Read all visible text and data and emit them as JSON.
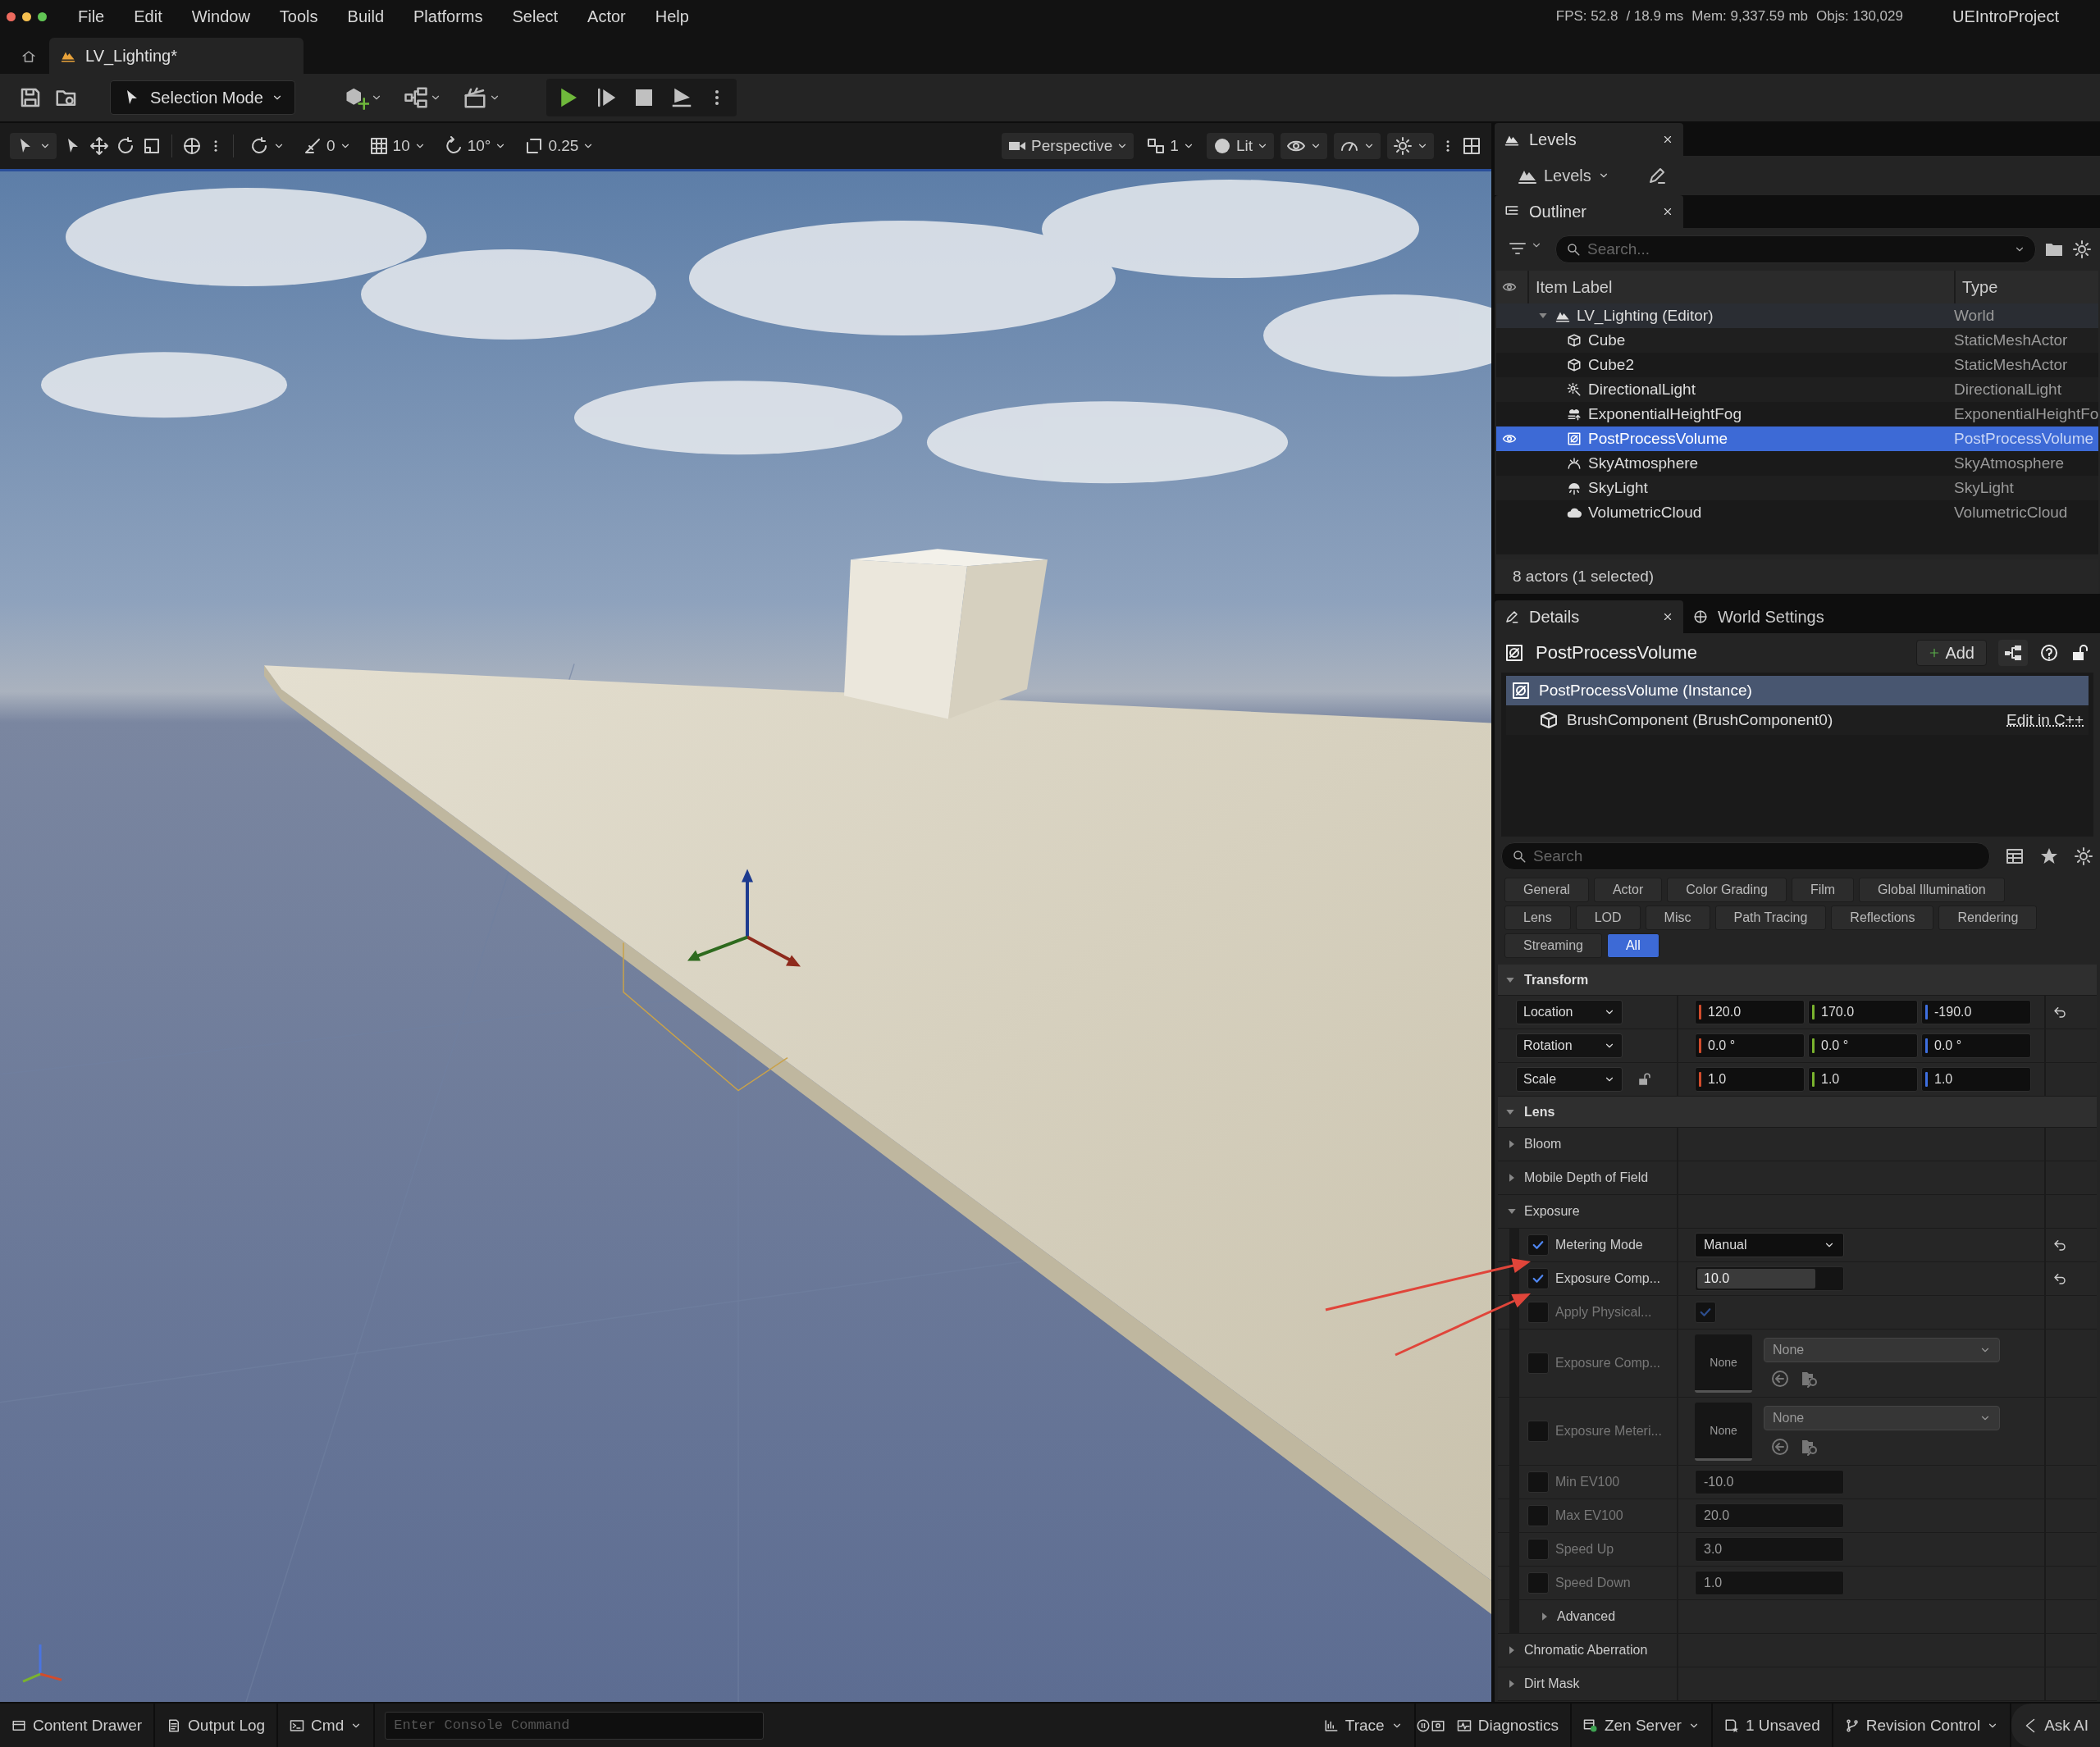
{
  "menu_bar": {
    "items": [
      "File",
      "Edit",
      "Window",
      "Tools",
      "Build",
      "Platforms",
      "Select",
      "Actor",
      "Help"
    ],
    "stats": [
      "FPS: 52.8",
      "/ 18.9 ms",
      "Mem: 9,337.59 mb",
      "Objs: 130,029"
    ],
    "project": "UEIntroProject"
  },
  "document_tab": {
    "label": "LV_Lighting*"
  },
  "toolbar": {
    "mode": "Selection Mode"
  },
  "viewport_toolbar": {
    "snaps": [
      {
        "kind": "surface",
        "value": "0"
      },
      {
        "kind": "grid",
        "value": "10"
      },
      {
        "kind": "rotation",
        "value": "10°"
      },
      {
        "kind": "scale",
        "value": "0.25"
      }
    ],
    "view_mode": "Perspective",
    "layout": "1",
    "lighting": "Lit"
  },
  "levels": {
    "tab": "Levels",
    "dropdown": "Levels"
  },
  "outliner": {
    "tab": "Outliner",
    "search": {
      "placeholder": "Search..."
    },
    "columns": [
      "Item Label",
      "Type"
    ],
    "rows": [
      {
        "kind": "world",
        "label": "LV_Lighting (Editor)",
        "type": "World",
        "selected": false,
        "expanded": true,
        "children": [
          {
            "kind": "mesh",
            "label": "Cube",
            "type": "StaticMeshActor",
            "selected": false
          },
          {
            "kind": "mesh",
            "label": "Cube2",
            "type": "StaticMeshActor",
            "selected": false
          },
          {
            "kind": "directional_light",
            "label": "DirectionalLight",
            "type": "DirectionalLight",
            "selected": false
          },
          {
            "kind": "fog",
            "label": "ExponentialHeightFog",
            "type": "ExponentialHeightFo",
            "selected": false
          },
          {
            "kind": "post_process",
            "label": "PostProcessVolume",
            "type": "PostProcessVolume",
            "selected": true
          },
          {
            "kind": "sky_atmosphere",
            "label": "SkyAtmosphere",
            "type": "SkyAtmosphere",
            "selected": false
          },
          {
            "kind": "sky_light",
            "label": "SkyLight",
            "type": "SkyLight",
            "selected": false
          },
          {
            "kind": "cloud",
            "label": "VolumetricCloud",
            "type": "VolumetricCloud",
            "selected": false
          }
        ]
      }
    ],
    "status": "8 actors (1 selected)"
  },
  "details": {
    "tabs": [
      {
        "label": "Details",
        "selected": true
      },
      {
        "label": "World Settings",
        "selected": false
      }
    ],
    "actor": "PostProcessVolume",
    "add_button": "Add",
    "components": [
      {
        "kind": "actor",
        "label": "PostProcessVolume (Instance)",
        "selected": true
      },
      {
        "kind": "component",
        "label": "BrushComponent (BrushComponent0)",
        "selected": false,
        "link": "Edit in C++"
      }
    ],
    "search": {
      "placeholder": "Search"
    },
    "filters": [
      [
        {
          "label": "General",
          "selected": false
        },
        {
          "label": "Actor",
          "selected": false
        },
        {
          "label": "Color Grading",
          "selected": false
        },
        {
          "label": "Film",
          "selected": false
        },
        {
          "label": "Global Illumination",
          "selected": false
        }
      ],
      [
        {
          "label": "Lens",
          "selected": false
        },
        {
          "label": "LOD",
          "selected": false
        },
        {
          "label": "Misc",
          "selected": false
        },
        {
          "label": "Path Tracing",
          "selected": false
        },
        {
          "label": "Reflections",
          "selected": false
        },
        {
          "label": "Rendering",
          "selected": false
        }
      ],
      [
        {
          "label": "Streaming",
          "selected": false
        },
        {
          "label": "All",
          "selected": true
        }
      ]
    ],
    "sections": [
      {
        "kind": "transform",
        "title": "Transform",
        "expanded": true,
        "rows": [
          {
            "label": "Location",
            "values": [
              "120.0",
              "170.0",
              "-190.0"
            ],
            "reset": true,
            "lock": false
          },
          {
            "label": "Rotation",
            "values": [
              "0.0 °",
              "0.0 °",
              "0.0 °"
            ],
            "reset": false,
            "lock": false
          },
          {
            "label": "Scale",
            "values": [
              "1.0",
              "1.0",
              "1.0"
            ],
            "reset": false,
            "lock": true
          }
        ]
      },
      {
        "kind": "groups",
        "title": "Lens",
        "expanded": true,
        "groups": [
          {
            "title": "Bloom",
            "expanded": false
          },
          {
            "title": "Mobile Depth of Field",
            "expanded": false
          },
          {
            "title": "Exposure",
            "expanded": true,
            "properties": [
              {
                "kind": "dropdown",
                "label": "Metering Mode",
                "checked": true,
                "value": "Manual",
                "reset": true
              },
              {
                "kind": "slider",
                "label": "Exposure Comp...",
                "checked": true,
                "value": "10.0",
                "level": 0.82,
                "reset": true
              },
              {
                "kind": "checkbox",
                "label": "Apply Physical...",
                "checked": false,
                "value_checked": true,
                "reset": false
              },
              {
                "kind": "asset",
                "label": "Exposure Comp...",
                "checked": false,
                "thumbnail": "None",
                "value": "None",
                "reset": false
              },
              {
                "kind": "asset",
                "label": "Exposure Meteri...",
                "checked": false,
                "thumbnail": "None",
                "value": "None",
                "reset": false
              },
              {
                "kind": "number",
                "label": "Min EV100",
                "checked": false,
                "value": "-10.0",
                "reset": false
              },
              {
                "kind": "number",
                "label": "Max EV100",
                "checked": false,
                "value": "20.0",
                "reset": false
              },
              {
                "kind": "number",
                "label": "Speed Up",
                "checked": false,
                "value": "3.0",
                "reset": false
              },
              {
                "kind": "number",
                "label": "Speed Down",
                "checked": false,
                "value": "1.0",
                "reset": false
              },
              {
                "kind": "group",
                "label": "Advanced",
                "expanded": false
              }
            ]
          },
          {
            "title": "Chromatic Aberration",
            "expanded": false
          },
          {
            "title": "Dirt Mask",
            "expanded": false
          }
        ]
      }
    ]
  },
  "status_bar": {
    "left": [
      {
        "kind": "content_drawer",
        "label": "Content Drawer"
      },
      {
        "kind": "output_log",
        "label": "Output Log"
      },
      {
        "kind": "cmd",
        "label": "Cmd"
      }
    ],
    "console": {
      "placeholder": "Enter Console Command"
    },
    "right": [
      {
        "kind": "trace",
        "label": "Trace"
      },
      {
        "kind": "diagnostics",
        "label": "Diagnostics"
      },
      {
        "kind": "zen_server",
        "label": "Zen Server"
      },
      {
        "kind": "unsaved",
        "label": "1 Unsaved"
      },
      {
        "kind": "revision_control",
        "label": "Revision Control"
      },
      {
        "kind": "ask_ai",
        "label": "Ask AI"
      }
    ]
  }
}
